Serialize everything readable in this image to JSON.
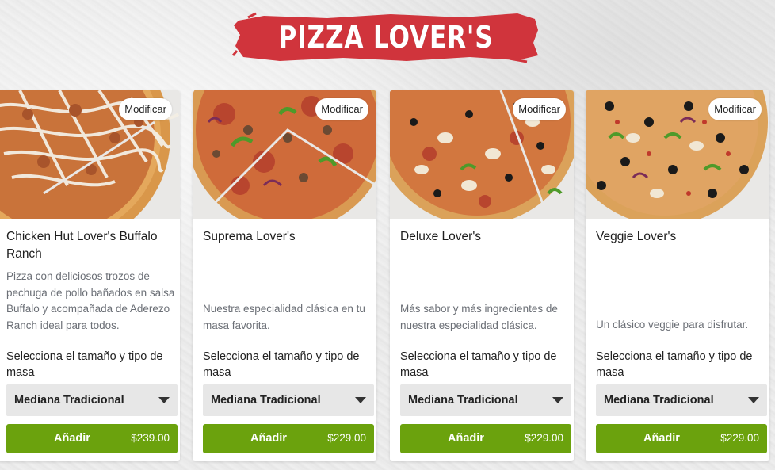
{
  "banner": {
    "title": "PIZZA LOVER'S"
  },
  "common": {
    "modify_label": "Modificar",
    "size_prompt": "Selecciona el tamaño y tipo de masa",
    "add_label": "Añadir"
  },
  "cards": [
    {
      "title": "Chicken Hut Lover's Buffalo Ranch",
      "description": "Pizza con deliciosos trozos de pechuga de pollo bañados en salsa Buffalo y acompañada de Aderezo Ranch ideal para todos.",
      "size_selected": "Mediana Tradicional",
      "price": "$239.00"
    },
    {
      "title": "Suprema Lover's",
      "description": "Nuestra especialidad clásica en tu masa favorita.",
      "size_selected": "Mediana Tradicional",
      "price": "$229.00"
    },
    {
      "title": "Deluxe Lover's",
      "description": "Más sabor y más ingredientes de nuestra especialidad clásica.",
      "size_selected": "Mediana Tradicional",
      "price": "$229.00"
    },
    {
      "title": "Veggie Lover's",
      "description": "Un clásico veggie para disfrutar.",
      "size_selected": "Mediana Tradicional",
      "price": "$229.00"
    }
  ],
  "colors": {
    "banner_red": "#d0343c",
    "add_button_green": "#6ba20d",
    "select_bg": "#e7e7e7"
  }
}
